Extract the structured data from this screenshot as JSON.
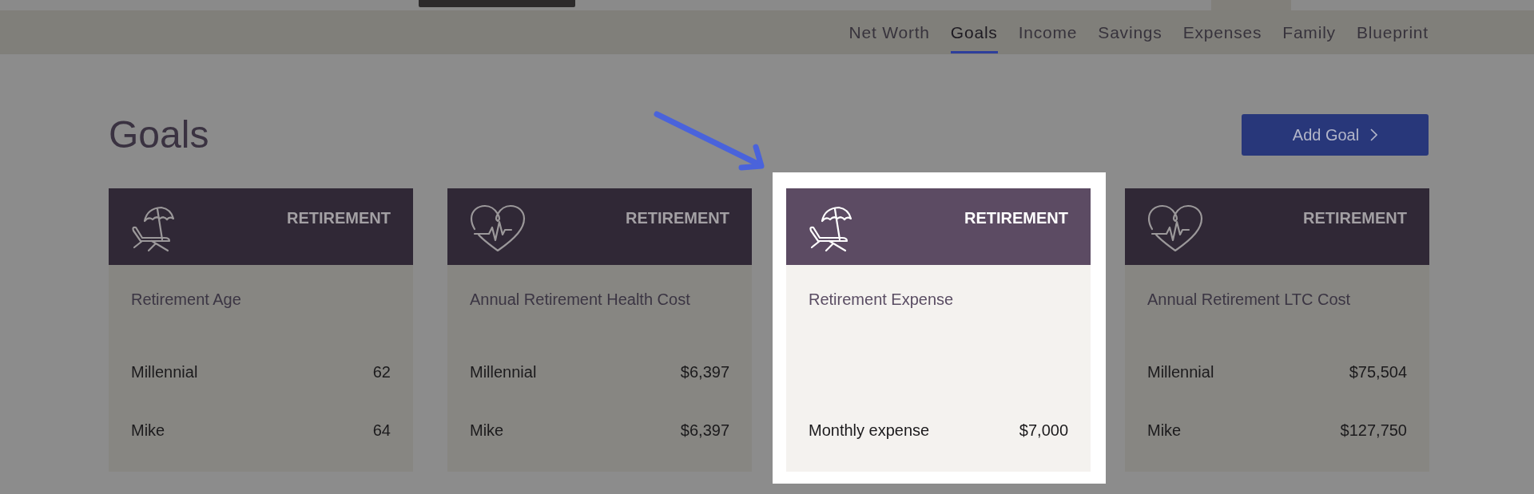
{
  "nav": {
    "tabs": [
      {
        "label": "Net Worth",
        "selected": false
      },
      {
        "label": "Goals",
        "selected": true
      },
      {
        "label": "Income",
        "selected": false
      },
      {
        "label": "Savings",
        "selected": false
      },
      {
        "label": "Expenses",
        "selected": false
      },
      {
        "label": "Family",
        "selected": false
      },
      {
        "label": "Blueprint",
        "selected": false
      }
    ]
  },
  "page": {
    "title": "Goals",
    "add_button": {
      "label": "Add Goal"
    }
  },
  "goal_cards": [
    {
      "category": "RETIREMENT",
      "kind": "beach",
      "title": "Retirement Age",
      "highlighted": false,
      "rows": [
        {
          "label": "Millennial",
          "value": "62"
        },
        {
          "label": "Mike",
          "value": "64"
        }
      ]
    },
    {
      "category": "RETIREMENT",
      "kind": "health",
      "title": "Annual Retirement Health Cost",
      "highlighted": false,
      "rows": [
        {
          "label": "Millennial",
          "value": "$6,397"
        },
        {
          "label": "Mike",
          "value": "$6,397"
        }
      ]
    },
    {
      "category": "RETIREMENT",
      "kind": "beach",
      "title": "Retirement Expense",
      "highlighted": true,
      "rows": [
        {
          "label": "Monthly expense",
          "value": "$7,000"
        }
      ]
    },
    {
      "category": "RETIREMENT",
      "kind": "health",
      "title": "Annual Retirement LTC Cost",
      "highlighted": false,
      "rows": [
        {
          "label": "Millennial",
          "value": "$75,504"
        },
        {
          "label": "Mike",
          "value": "$127,750"
        }
      ]
    }
  ]
}
